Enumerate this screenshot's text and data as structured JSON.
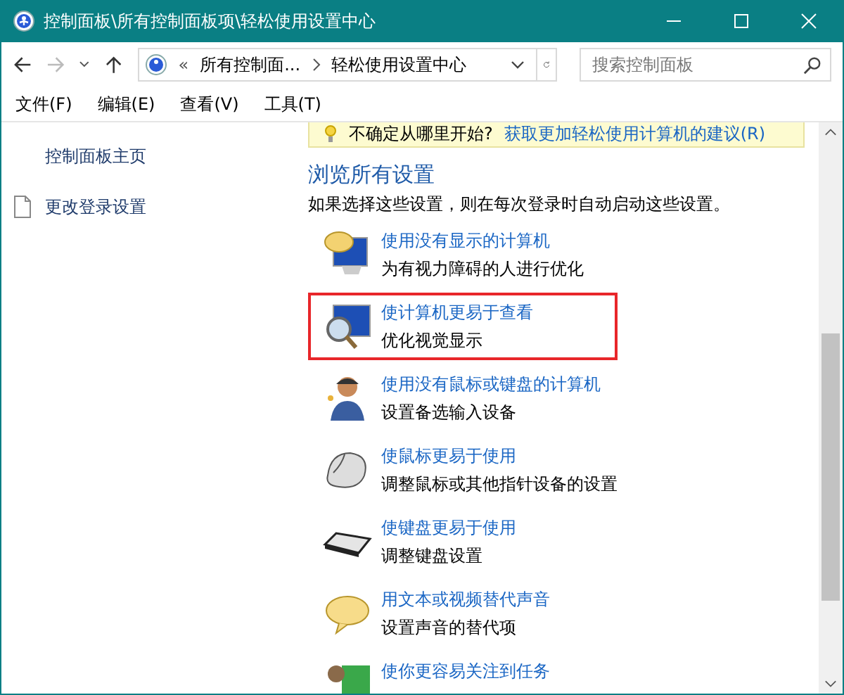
{
  "window": {
    "title": "控制面板\\所有控制面板项\\轻松使用设置中心"
  },
  "address_bar": {
    "back": "«",
    "crumbs": [
      "所有控制面...",
      "轻松使用设置中心"
    ]
  },
  "search": {
    "placeholder": "搜索控制面板"
  },
  "menu": [
    "文件(F)",
    "编辑(E)",
    "查看(V)",
    "工具(T)"
  ],
  "sidebar": {
    "items": [
      {
        "label": "控制面板主页",
        "kind": "plain"
      },
      {
        "label": "更改登录设置",
        "kind": "document"
      }
    ]
  },
  "tip": {
    "question": "不确定从哪里开始?",
    "link": "获取更加轻松使用计算机的建议(R)"
  },
  "section": {
    "title": "浏览所有设置",
    "description": "如果选择这些设置，则在每次登录时自动启动这些设置。"
  },
  "items": [
    {
      "kind": "narrator",
      "link": "使用没有显示的计算机",
      "description": "为有视力障碍的人进行优化",
      "highlighted": false
    },
    {
      "kind": "magnifier",
      "link": "使计算机更易于查看",
      "description": "优化视觉显示",
      "highlighted": true
    },
    {
      "kind": "person",
      "link": "使用没有鼠标或键盘的计算机",
      "description": "设置备选输入设备",
      "highlighted": false
    },
    {
      "kind": "mouse",
      "link": "使鼠标更易于使用",
      "description": "调整鼠标或其他指针设备的设置",
      "highlighted": false
    },
    {
      "kind": "keyboard",
      "link": "使键盘更易于使用",
      "description": "调整键盘设置",
      "highlighted": false
    },
    {
      "kind": "speech",
      "link": "用文本或视频替代声音",
      "description": "设置声音的替代项",
      "highlighted": false
    },
    {
      "kind": "task",
      "link": "使你更容易关注到任务",
      "highlighted": false
    }
  ]
}
